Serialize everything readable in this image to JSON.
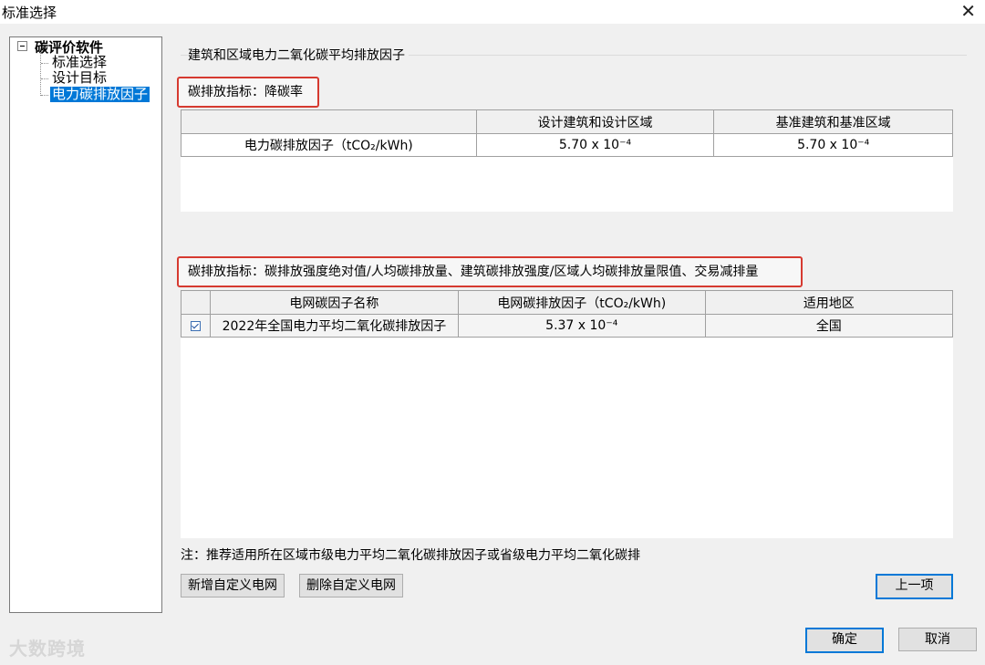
{
  "window": {
    "title": "标准选择",
    "close_glyph": "✕"
  },
  "tree": {
    "root": "碳评价软件",
    "items": [
      {
        "label": "标准选择",
        "selected": false
      },
      {
        "label": "设计目标",
        "selected": false
      },
      {
        "label": "电力碳排放因子",
        "selected": true
      }
    ]
  },
  "group": {
    "title": "建筑和区域电力二氧化碳平均排放因子"
  },
  "section1": {
    "label": "碳排放指标：降碳率",
    "headers": [
      "",
      "设计建筑和设计区域",
      "基准建筑和基准区域"
    ],
    "rows": [
      [
        "电力碳排放因子（tCO₂/kWh)",
        "5.70 x 10⁻⁴",
        "5.70 x 10⁻⁴"
      ]
    ]
  },
  "section2": {
    "label": "碳排放指标：碳排放强度绝对值/人均碳排放量、建筑碳排放强度/区域人均碳排放量限值、交易减排量",
    "headers": [
      "",
      "电网碳因子名称",
      "电网碳排放因子（tCO₂/kWh)",
      "适用地区"
    ],
    "rows": [
      {
        "checked": true,
        "name": "2022年全国电力平均二氧化碳排放因子",
        "factor": "5.37 x 10⁻⁴",
        "region": "全国"
      }
    ]
  },
  "note": "注：推荐适用所在区域市级电力平均二氧化碳排放因子或省级电力平均二氧化碳排",
  "buttons": {
    "add_grid": "新增自定义电网",
    "delete_grid": "删除自定义电网",
    "previous": "上一项",
    "ok": "确定",
    "cancel": "取消"
  },
  "watermark": "大数跨境"
}
